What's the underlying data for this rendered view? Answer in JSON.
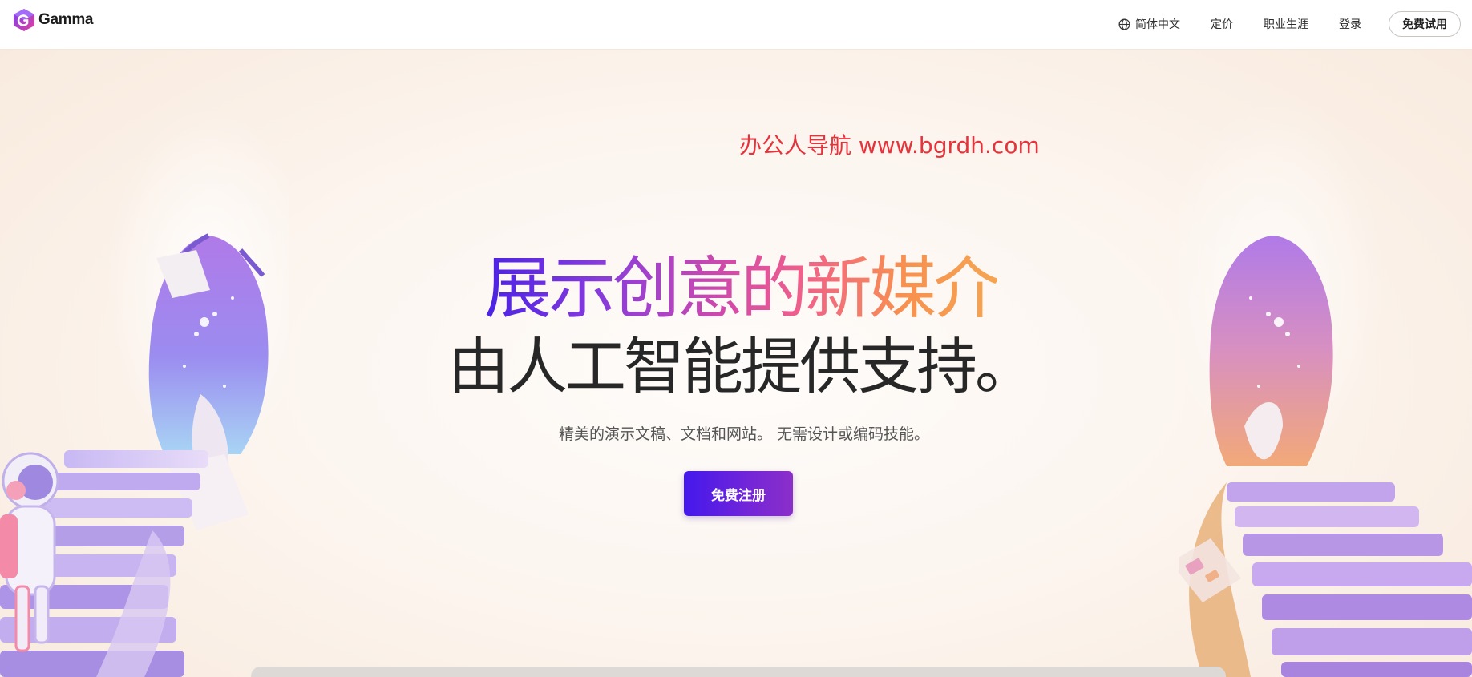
{
  "nav": {
    "brand": "Gamma",
    "language": "简体中文",
    "pricing": "定价",
    "careers": "职业生涯",
    "login": "登录",
    "try_free": "免费试用"
  },
  "watermark": "办公人导航 www.bgrdh.com",
  "hero": {
    "headline_gradient": "展示创意的新媒介",
    "headline_dark": "由人工智能提供支持。",
    "subtitle": "精美的演示文稿、文档和网站。 无需设计或编码技能。",
    "signup_label": "免费注册"
  },
  "colors": {
    "brand_purple": "#4418ec",
    "gradient_start": "#4a22e6",
    "gradient_end": "#f5a552",
    "watermark_red": "#e6323a"
  },
  "icons": {
    "logo": "gamma-logo-icon",
    "language": "globe-icon"
  }
}
